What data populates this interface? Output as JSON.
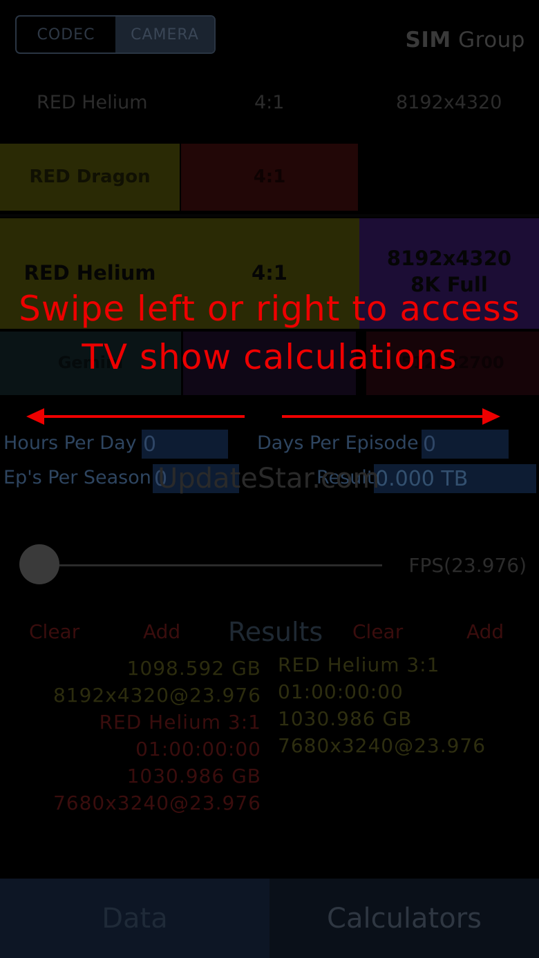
{
  "segmented": {
    "codec": "CODEC",
    "camera": "CAMERA"
  },
  "brand": {
    "sim": "SIM",
    "group": "Group"
  },
  "header": {
    "camera": "RED Helium",
    "ratio": "4:1",
    "resolution": "8192x4320"
  },
  "picker": {
    "top_row": {
      "camera": "RED Dragon",
      "ratio": "4:1"
    },
    "selected_row": {
      "camera": "RED Helium",
      "ratio": "4:1",
      "resolution": "8192x4320",
      "resolution_sub": "8K Full"
    },
    "bottom_row": {
      "camera": "Gemini",
      "ratio": "",
      "resolution": "5120x2700"
    }
  },
  "overlay": {
    "line1": "Swipe left or right to access",
    "line2": "TV show calculations"
  },
  "tv": {
    "hours_label": "Hours Per Day",
    "hours_value": "0",
    "days_label": "Days Per Episode",
    "days_value": "0",
    "eps_label": "Ep's Per Season",
    "eps_value": "0",
    "result_label": "Result",
    "result_value": "0.000 TB"
  },
  "watermark": "UpdateStar.com",
  "fps_label": "FPS(23.976)",
  "fps_slider": {
    "min": 0,
    "max": 1,
    "value": 0
  },
  "results": {
    "clear_left": "Clear",
    "add_left": "Add",
    "title": "Results",
    "clear_right": "Clear",
    "add_right": "Add",
    "left": {
      "size1": "1098.592 GB",
      "spec1": "8192x4320@23.976",
      "camera2": "RED Helium 3:1",
      "tc2": "01:00:00:00",
      "size2": "1030.986 GB",
      "spec2": "7680x3240@23.976"
    },
    "right": {
      "camera": "RED Helium 3:1",
      "tc": "01:00:00:00",
      "size": "1030.986 GB",
      "spec": "7680x3240@23.976"
    }
  },
  "tabs": {
    "data": "Data",
    "calculators": "Calculators"
  },
  "colors": {
    "overlay_red": "#ee0000",
    "yellow_cell": "#2a2a05",
    "purple_cell": "#1c0d35",
    "red_cell": "#220707",
    "field_blue": "#0d1c33",
    "left_tab": "#0d1625",
    "right_tab": "#0a1019"
  }
}
